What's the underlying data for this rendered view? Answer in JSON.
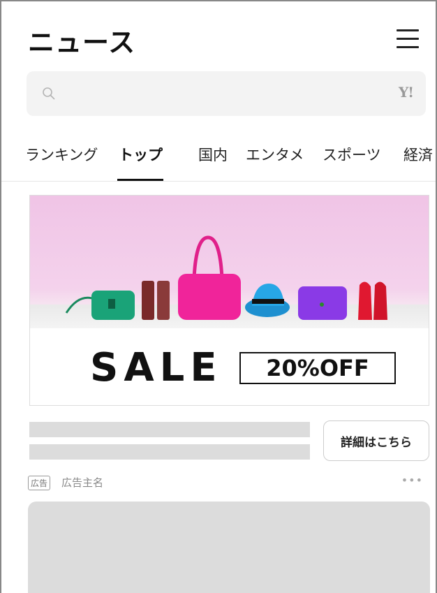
{
  "header": {
    "logo": "ニュース",
    "menu_icon": "hamburger-menu-icon"
  },
  "search": {
    "placeholder": "",
    "value": "",
    "search_icon": "search-icon",
    "brand_mark": "Y!"
  },
  "tabs": [
    {
      "label": "ランキング",
      "active": false
    },
    {
      "label": "トップ",
      "active": true
    },
    {
      "label": "国内",
      "active": false
    },
    {
      "label": "エンタメ",
      "active": false
    },
    {
      "label": "スポーツ",
      "active": false
    },
    {
      "label": "経済",
      "active": false
    }
  ],
  "ad": {
    "banner": {
      "headline": "SALE",
      "discount": "20%OFF"
    },
    "cta_label": "詳細はこちら",
    "badge": "広告",
    "advertiser": "広告主名",
    "more_icon": "more-horizontal-icon"
  },
  "colors": {
    "banner_background": "#f2c9e8",
    "skeleton": "#dcdcdc",
    "search_background": "#f3f3f3"
  }
}
